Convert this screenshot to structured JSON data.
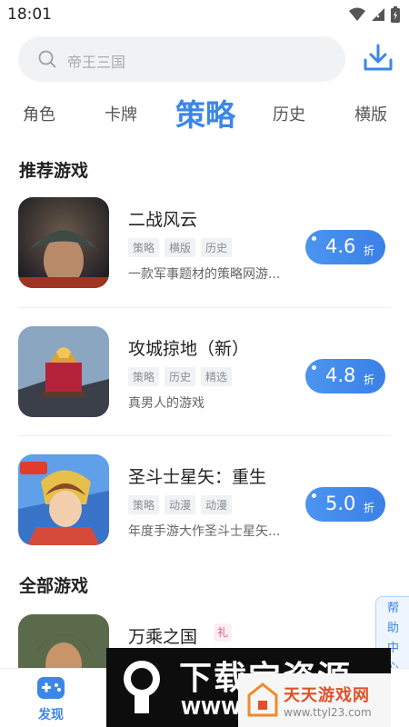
{
  "status_bar": {
    "time": "18:01"
  },
  "search": {
    "placeholder": "帝王三国"
  },
  "tabs": [
    {
      "label": "角色",
      "active": false
    },
    {
      "label": "卡牌",
      "active": false
    },
    {
      "label": "策略",
      "active": true
    },
    {
      "label": "历史",
      "active": false
    },
    {
      "label": "横版",
      "active": false
    }
  ],
  "sections": {
    "recommended": "推荐游戏",
    "all": "全部游戏"
  },
  "recommended_games": [
    {
      "name": "二战风云",
      "tags": [
        "策略",
        "横版",
        "历史"
      ],
      "description": "一款军事题材的策略网游...",
      "discount": "4.6",
      "discount_unit": "折"
    },
    {
      "name": "攻城掠地（新）",
      "tags": [
        "策略",
        "历史",
        "精选"
      ],
      "description": "真男人的游戏",
      "discount": "4.8",
      "discount_unit": "折"
    },
    {
      "name": "圣斗士星矢：重生",
      "tags": [
        "策略",
        "动漫",
        "动漫"
      ],
      "description": "年度手游大作圣斗士星矢...",
      "discount": "5.0",
      "discount_unit": "折"
    }
  ],
  "all_games": [
    {
      "name": "万乘之国",
      "badge": "礼"
    }
  ],
  "help_tab": {
    "chars": [
      "帮",
      "助",
      "中",
      "心"
    ]
  },
  "bottom_nav": {
    "discover_label": "发现"
  },
  "watermark": {
    "big_text": "下载宝资源",
    "left_url": "WWW",
    "right_cn": "天天游戏网",
    "right_url": "www.ttyl23.com"
  },
  "colors": {
    "accent": "#3b86e8",
    "discount_bg": "#4b95f0",
    "gift": "#e0577f"
  }
}
